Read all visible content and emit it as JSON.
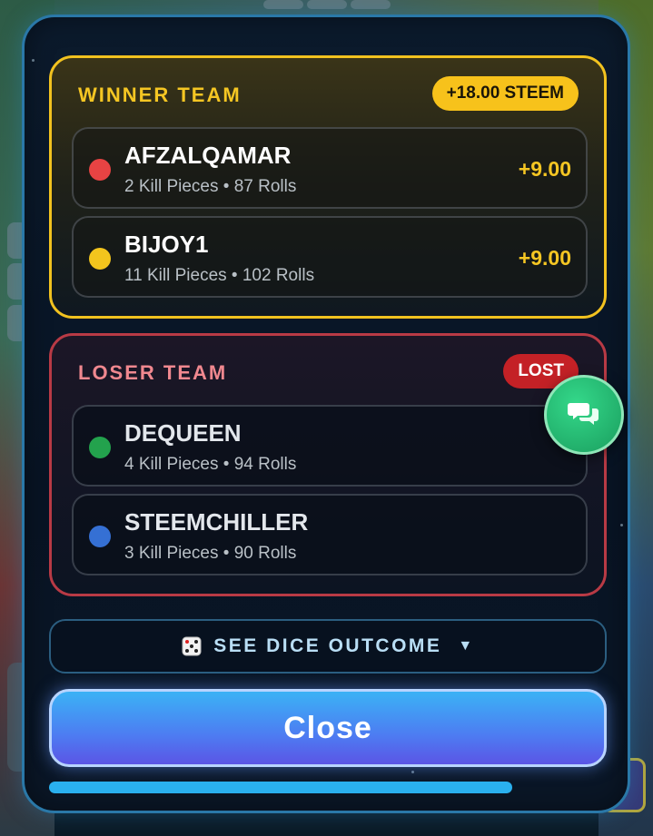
{
  "winner": {
    "title": "WINNER TEAM",
    "badge": "+18.00 STEEM",
    "color": "#f5c623",
    "players": [
      {
        "name": "AFZALQAMAR",
        "stats": "2 Kill Pieces • 87 Rolls",
        "score": "+9.00",
        "dot_color": "#e84343"
      },
      {
        "name": "BIJOY1",
        "stats": "11 Kill Pieces • 102 Rolls",
        "score": "+9.00",
        "dot_color": "#f3c51d"
      }
    ]
  },
  "loser": {
    "title": "LOSER TEAM",
    "badge": "LOST",
    "color": "#f0888f",
    "players": [
      {
        "name": "DEQUEEN",
        "stats": "4 Kill Pieces • 94 Rolls",
        "dot_color": "#23a24d"
      },
      {
        "name": "STEEMCHILLER",
        "stats": "3 Kill Pieces • 90 Rolls",
        "dot_color": "#3570d4"
      }
    ]
  },
  "dice_outcome": {
    "label": "SEE DICE OUTCOME",
    "icon": "dice-icon",
    "caret": "▼"
  },
  "close": {
    "label": "Close"
  },
  "progress": {
    "fraction": 0.83
  },
  "chat": {
    "icon": "chat-bubbles-icon"
  }
}
